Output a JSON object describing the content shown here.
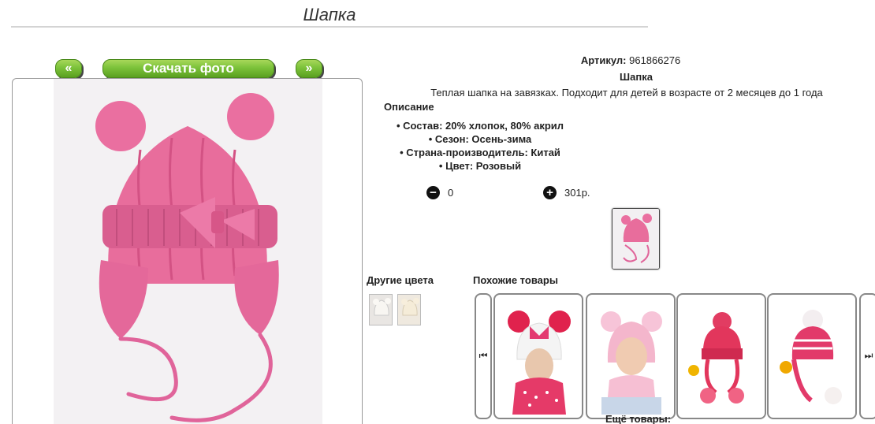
{
  "page": {
    "title": "Шапка"
  },
  "toolbar": {
    "prev_label": "«",
    "download_label": "Скачать фото",
    "next_label": "»"
  },
  "product": {
    "article_label": "Артикул:",
    "article_value": "961866276",
    "name": "Шапка",
    "description": "Теплая шапка на завязках. Подходит для детей в возрасте от 2 месяцев до 1 года",
    "description_heading": "Описание",
    "properties": [
      "Состав: 20% хлопок, 80% акрил",
      "Сезон: Осень-зима",
      "Страна-производитель: Китай",
      "Цвет: Розовый"
    ],
    "main_color": "#e0608e"
  },
  "cart": {
    "minus_icon": "minus-circle-icon",
    "quantity": "0",
    "plus_icon": "plus-circle-icon",
    "price": "301р."
  },
  "other_colors": {
    "heading": "Другие цвета"
  },
  "similar": {
    "heading": "Похожие товары",
    "more_label": "Ещё товары:"
  }
}
